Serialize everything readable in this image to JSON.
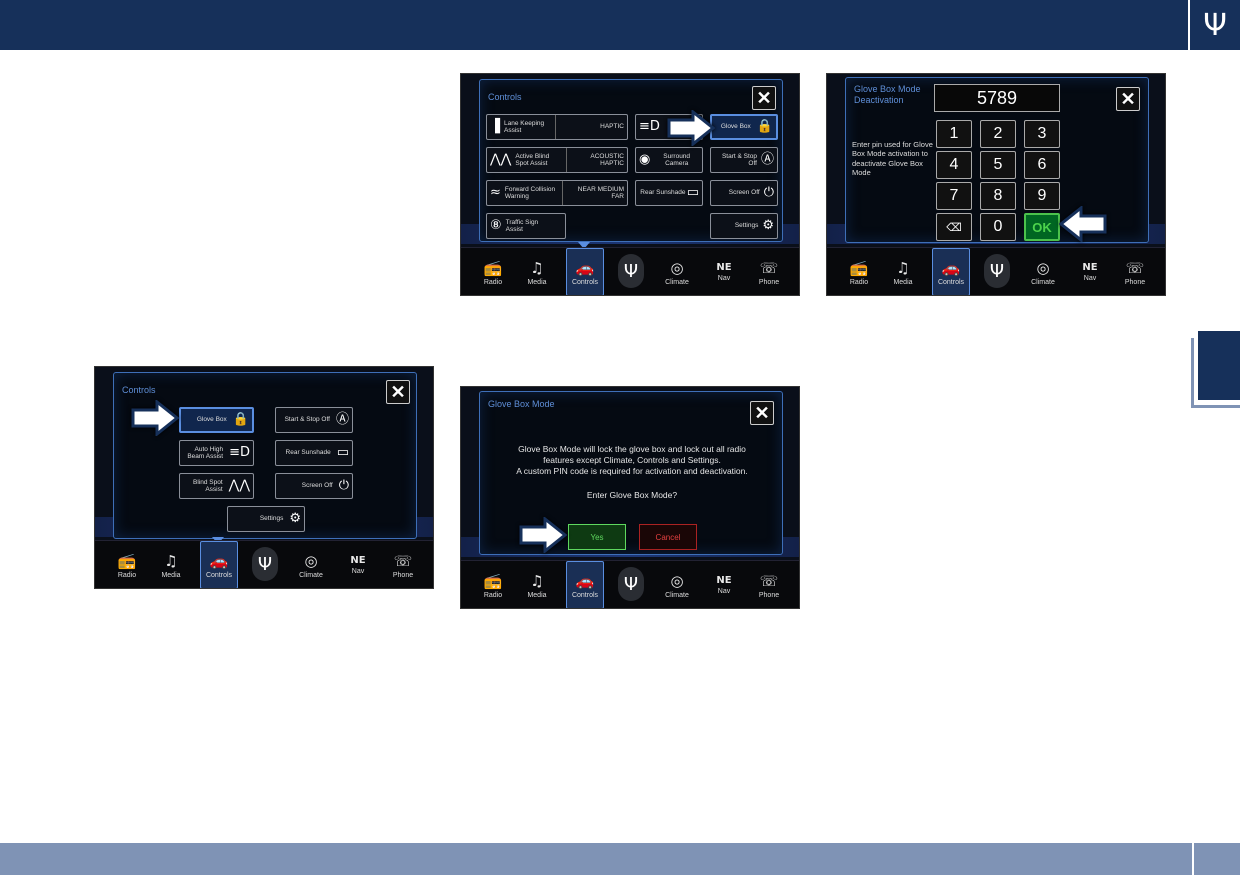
{
  "header": {
    "logo_icon": "trident-logo-icon"
  },
  "nav": [
    {
      "label": "Radio",
      "icon": "radio-icon",
      "glyph": "📻"
    },
    {
      "label": "Media",
      "icon": "media-icon",
      "glyph": "♫"
    },
    {
      "label": "Controls",
      "icon": "controls-car-icon",
      "glyph": "🚗"
    },
    {
      "label": "",
      "icon": "trident-icon",
      "glyph": "Ψ"
    },
    {
      "label": "Climate",
      "icon": "climate-icon",
      "glyph": "◎"
    },
    {
      "label": "Nav",
      "icon": "nav-compass-icon",
      "glyph": "NE"
    },
    {
      "label": "Phone",
      "icon": "phone-icon",
      "glyph": "☏"
    }
  ],
  "screen1": {
    "title": "Controls",
    "close": "✕",
    "buttons": [
      {
        "label": "Glove Box",
        "icon": "lock-icon",
        "glyph": "🔒"
      },
      {
        "label": "Start & Stop Off",
        "icon": "start-stop-icon",
        "glyph": "Ⓐ"
      },
      {
        "label": "Auto High Beam Assist",
        "icon": "high-beam-icon",
        "glyph": "≡D"
      },
      {
        "label": "Rear Sunshade",
        "icon": "sunshade-icon",
        "glyph": "▭"
      },
      {
        "label": "Blind Spot Assist",
        "icon": "blind-spot-icon",
        "glyph": "⋀⋀"
      },
      {
        "label": "Screen Off",
        "icon": "screen-off-icon",
        "glyph": "⏻"
      },
      {
        "label": "Settings",
        "icon": "settings-gear-icon",
        "glyph": "⚙"
      }
    ]
  },
  "screen2": {
    "title": "Controls",
    "close": "✕",
    "buttons": [
      {
        "label": "Lane Keeping Assist",
        "value": "HAPTIC",
        "icon": "lane-keeping-icon",
        "glyph": "▐"
      },
      {
        "label": "Active Blind Spot Assist",
        "value": "ACOUSTIC HAPTIC",
        "icon": "blind-spot-icon",
        "glyph": "⋀⋀"
      },
      {
        "label": "Forward Collision Warning",
        "value": "NEAR MEDIUM FAR",
        "icon": "collision-icon",
        "glyph": "≈"
      },
      {
        "label": "Traffic Sign Assist",
        "icon": "traffic-sign-icon",
        "glyph": "⑧"
      },
      {
        "label": "",
        "icon": "high-beam-icon",
        "glyph": "≡D"
      },
      {
        "label": "Surround Camera",
        "icon": "camera-icon",
        "glyph": "◉"
      },
      {
        "label": "Rear Sunshade",
        "icon": "sunshade-icon",
        "glyph": "▭"
      },
      {
        "label": "Glove Box",
        "icon": "lock-icon",
        "glyph": "🔒"
      },
      {
        "label": "Start & Stop Off",
        "icon": "start-stop-icon",
        "glyph": "Ⓐ"
      },
      {
        "label": "Screen Off",
        "icon": "screen-off-icon",
        "glyph": "⏻"
      },
      {
        "label": "Settings",
        "icon": "settings-gear-icon",
        "glyph": "⚙"
      }
    ]
  },
  "screen3": {
    "title": "Glove Box Mode Deactivation",
    "pin": "5789",
    "close": "✕",
    "instructions": "Enter pin used for Glove Box Mode activation to deactivate Glove Box Mode",
    "keys": [
      "1",
      "2",
      "3",
      "4",
      "5",
      "6",
      "7",
      "8",
      "9",
      "⌫",
      "0",
      "OK"
    ]
  },
  "screen4": {
    "title": "Glove Box Mode",
    "close": "✕",
    "message_line1": "Glove Box Mode will lock the glove box and lock out all radio",
    "message_line2": "features except Climate, Controls and Settings.",
    "message_line3": "A custom PIN code is required for activation and deactivation.",
    "question": "Enter Glove Box Mode?",
    "yes": "Yes",
    "cancel": "Cancel"
  }
}
